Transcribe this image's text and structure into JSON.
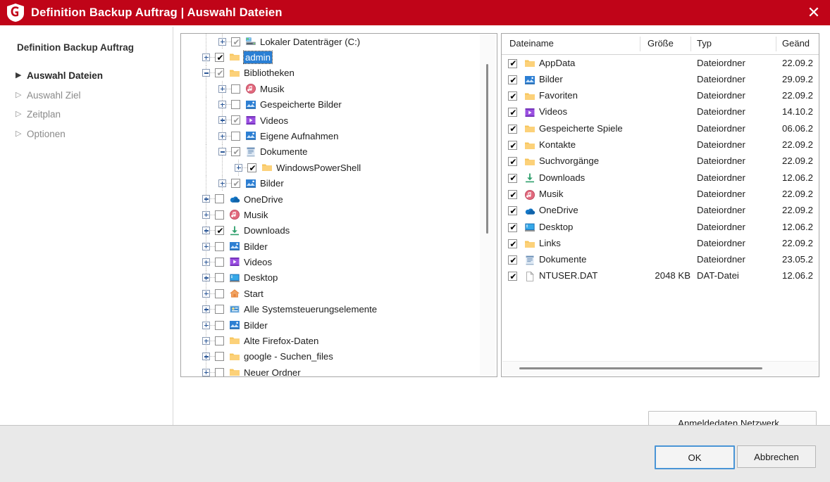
{
  "window": {
    "title": "Definition Backup Auftrag | Auswahl Dateien",
    "logo_icon": "gdata-shield-icon",
    "close_icon": "close-icon",
    "titlebar_color": "#c00418"
  },
  "sidebar": {
    "heading": "Definition Backup Auftrag",
    "items": [
      {
        "label": "Auswahl Dateien",
        "active": true
      },
      {
        "label": "Auswahl Ziel",
        "active": false
      },
      {
        "label": "Zeitplan",
        "active": false
      },
      {
        "label": "Optionen",
        "active": false
      }
    ]
  },
  "tree": {
    "nodes": [
      {
        "label": "Lokaler Datenträger (C:)",
        "depth": 1,
        "check": "partial",
        "expander": "plus",
        "icon": "drive-icon",
        "selected": false
      },
      {
        "label": "admin",
        "depth": 0,
        "check": "full",
        "expander": "plus",
        "icon": "folder-icon",
        "selected": true
      },
      {
        "label": "Bibliotheken",
        "depth": 0,
        "check": "partial",
        "expander": "minus",
        "icon": "folder-icon",
        "selected": false
      },
      {
        "label": "Musik",
        "depth": 1,
        "check": "none",
        "expander": "plus",
        "icon": "music-icon",
        "selected": false
      },
      {
        "label": "Gespeicherte Bilder",
        "depth": 1,
        "check": "none",
        "expander": "plus",
        "icon": "pictures-icon",
        "selected": false
      },
      {
        "label": "Videos",
        "depth": 1,
        "check": "partial",
        "expander": "plus",
        "icon": "videos-icon",
        "selected": false
      },
      {
        "label": "Eigene Aufnahmen",
        "depth": 1,
        "check": "none",
        "expander": "plus",
        "icon": "pictures-icon",
        "selected": false
      },
      {
        "label": "Dokumente",
        "depth": 1,
        "check": "partial",
        "expander": "minus",
        "icon": "documents-icon",
        "selected": false
      },
      {
        "label": "WindowsPowerShell",
        "depth": 2,
        "check": "full",
        "expander": "plus",
        "icon": "folder-icon",
        "selected": false
      },
      {
        "label": "Bilder",
        "depth": 1,
        "check": "partial",
        "expander": "plus",
        "icon": "pictures-icon",
        "selected": false
      },
      {
        "label": "OneDrive",
        "depth": 0,
        "check": "none",
        "expander": "plus",
        "icon": "onedrive-icon",
        "selected": false
      },
      {
        "label": "Musik",
        "depth": 0,
        "check": "none",
        "expander": "plus",
        "icon": "music-icon",
        "selected": false
      },
      {
        "label": "Downloads",
        "depth": 0,
        "check": "full",
        "expander": "plus",
        "icon": "downloads-icon",
        "selected": false
      },
      {
        "label": "Bilder",
        "depth": 0,
        "check": "none",
        "expander": "plus",
        "icon": "pictures-icon",
        "selected": false
      },
      {
        "label": "Videos",
        "depth": 0,
        "check": "none",
        "expander": "plus",
        "icon": "videos-icon",
        "selected": false
      },
      {
        "label": "Desktop",
        "depth": 0,
        "check": "none",
        "expander": "plus",
        "icon": "desktop-icon",
        "selected": false
      },
      {
        "label": "Start",
        "depth": 0,
        "check": "none",
        "expander": "plus",
        "icon": "home-icon",
        "selected": false
      },
      {
        "label": "Alle Systemsteuerungselemente",
        "depth": 0,
        "check": "none",
        "expander": "plus",
        "icon": "controlpanel-icon",
        "selected": false
      },
      {
        "label": "Bilder",
        "depth": 0,
        "check": "none",
        "expander": "plus",
        "icon": "pictures-icon",
        "selected": false
      },
      {
        "label": "Alte Firefox-Daten",
        "depth": 0,
        "check": "none",
        "expander": "plus",
        "icon": "folder-icon",
        "selected": false
      },
      {
        "label": "google - Suchen_files",
        "depth": 0,
        "check": "none",
        "expander": "plus",
        "icon": "folder-icon",
        "selected": false
      },
      {
        "label": "Neuer Ordner",
        "depth": 0,
        "check": "none",
        "expander": "plus",
        "icon": "folder-icon",
        "selected": false
      }
    ]
  },
  "filelist": {
    "columns": [
      "Dateiname",
      "Größe",
      "Typ",
      "Geändert"
    ],
    "column_last_truncated": "Geänd",
    "rows": [
      {
        "name": "AppData",
        "size": "",
        "type": "Dateiordner",
        "modified": "22.09.2",
        "icon": "folder-icon",
        "checked": true
      },
      {
        "name": "Bilder",
        "size": "",
        "type": "Dateiordner",
        "modified": "29.09.2",
        "icon": "pictures-icon",
        "checked": true
      },
      {
        "name": "Favoriten",
        "size": "",
        "type": "Dateiordner",
        "modified": "22.09.2",
        "icon": "folder-icon",
        "checked": true
      },
      {
        "name": "Videos",
        "size": "",
        "type": "Dateiordner",
        "modified": "14.10.2",
        "icon": "videos-icon",
        "checked": true
      },
      {
        "name": "Gespeicherte Spiele",
        "size": "",
        "type": "Dateiordner",
        "modified": "06.06.2",
        "icon": "folder-icon",
        "checked": true
      },
      {
        "name": "Kontakte",
        "size": "",
        "type": "Dateiordner",
        "modified": "22.09.2",
        "icon": "folder-icon",
        "checked": true
      },
      {
        "name": "Suchvorgänge",
        "size": "",
        "type": "Dateiordner",
        "modified": "22.09.2",
        "icon": "folder-icon",
        "checked": true
      },
      {
        "name": "Downloads",
        "size": "",
        "type": "Dateiordner",
        "modified": "12.06.2",
        "icon": "downloads-icon",
        "checked": true
      },
      {
        "name": "Musik",
        "size": "",
        "type": "Dateiordner",
        "modified": "22.09.2",
        "icon": "music-icon",
        "checked": true
      },
      {
        "name": "OneDrive",
        "size": "",
        "type": "Dateiordner",
        "modified": "22.09.2",
        "icon": "onedrive-icon",
        "checked": true
      },
      {
        "name": "Desktop",
        "size": "",
        "type": "Dateiordner",
        "modified": "12.06.2",
        "icon": "desktop-icon",
        "checked": true
      },
      {
        "name": "Links",
        "size": "",
        "type": "Dateiordner",
        "modified": "22.09.2",
        "icon": "folder-icon",
        "checked": true
      },
      {
        "name": "Dokumente",
        "size": "",
        "type": "Dateiordner",
        "modified": "23.05.2",
        "icon": "documents-icon",
        "checked": true
      },
      {
        "name": "NTUSER.DAT",
        "size": "2048 KB",
        "type": "DAT-Datei",
        "modified": "12.06.2",
        "icon": "file-icon",
        "checked": true
      }
    ]
  },
  "buttons": {
    "network_credentials": "Anmeldedaten Netzwerk...",
    "ok": "OK",
    "cancel": "Abbrechen"
  }
}
